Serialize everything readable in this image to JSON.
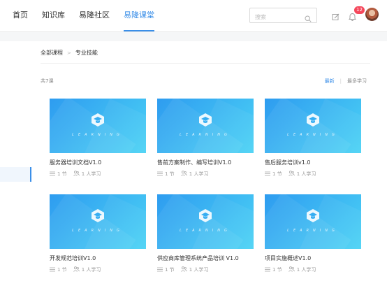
{
  "nav": {
    "items": [
      "首页",
      "知识库",
      "易隆社区",
      "易隆课堂"
    ],
    "active": 3
  },
  "search": {
    "placeholder": "搜索"
  },
  "notifications": {
    "count": "12"
  },
  "breadcrumb": {
    "root": "全部课程",
    "separator": ">",
    "current": "专业技能"
  },
  "list": {
    "count_label": "共7课",
    "sort_latest": "最新",
    "sort_separator": "|",
    "sort_popular": "最多学习"
  },
  "thumb_caption": "LEARNING",
  "courses": [
    {
      "title": "服务器培训文档V1.0",
      "lessons": "1 节",
      "students": "1 人学习"
    },
    {
      "title": "售前方案制作、编写培训V1.0",
      "lessons": "1 节",
      "students": "1 人学习"
    },
    {
      "title": "售后服务培训v1.0",
      "lessons": "1 节",
      "students": "1 人学习"
    },
    {
      "title": "开发规范培训V1.0",
      "lessons": "1 节",
      "students": "1 人学习"
    },
    {
      "title": "供应商库管理系统产品培训 V1.0",
      "lessons": "1 节",
      "students": "1 人学习"
    },
    {
      "title": "项目实施概述V1.0",
      "lessons": "1 节",
      "students": "1 人学习"
    }
  ],
  "colors": {
    "accent": "#3b8fe8",
    "badge": "#f5475b",
    "thumb_start": "#2e9cf0",
    "thumb_end": "#4cd3f5"
  }
}
